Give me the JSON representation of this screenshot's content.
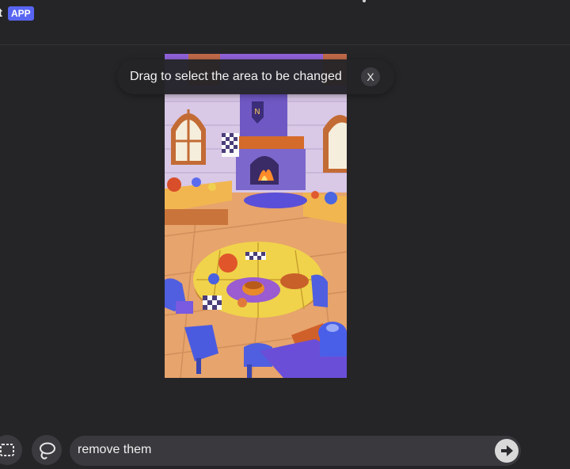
{
  "header": {
    "app_name_fragment": "t",
    "app_badge": "APP"
  },
  "tooltip": {
    "text": "Drag to select the area to be changed",
    "close_label": "X"
  },
  "prompt": {
    "value": "remove them"
  },
  "colors": {
    "background": "#252528",
    "badge": "#5865f2",
    "tooltip_bg": "#242428",
    "prompt_bg": "#39393e"
  },
  "icons": {
    "select_tool": "dashed-rectangle-icon",
    "lasso_tool": "lasso-icon",
    "send": "arrow-right-icon",
    "close": "close-icon"
  }
}
